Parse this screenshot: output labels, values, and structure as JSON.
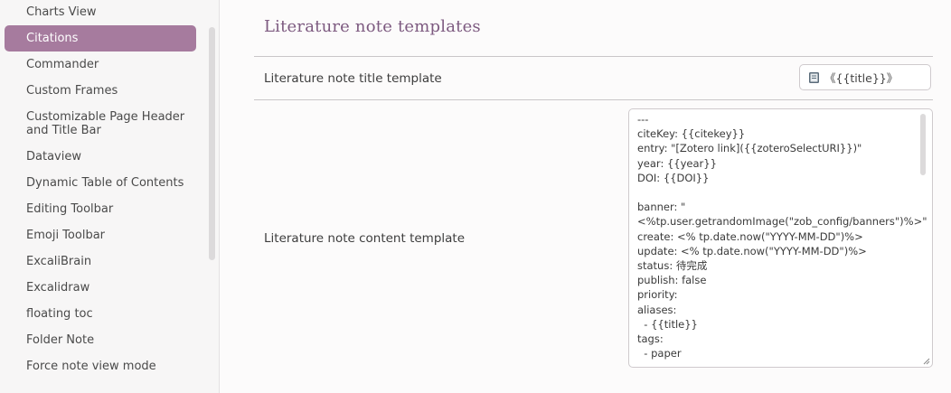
{
  "sidebar": {
    "items": [
      {
        "label": "Charts View",
        "active": false
      },
      {
        "label": "Citations",
        "active": true
      },
      {
        "label": "Commander",
        "active": false
      },
      {
        "label": "Custom Frames",
        "active": false
      },
      {
        "label": "Customizable Page Header and Title Bar",
        "active": false
      },
      {
        "label": "Dataview",
        "active": false
      },
      {
        "label": "Dynamic Table of Contents",
        "active": false
      },
      {
        "label": "Editing Toolbar",
        "active": false
      },
      {
        "label": "Emoji Toolbar",
        "active": false
      },
      {
        "label": "ExcaliBrain",
        "active": false
      },
      {
        "label": "Excalidraw",
        "active": false
      },
      {
        "label": "floating toc",
        "active": false
      },
      {
        "label": "Folder Note",
        "active": false
      },
      {
        "label": "Force note view mode",
        "active": false
      }
    ]
  },
  "main": {
    "section_title": "Literature note templates",
    "title_template": {
      "label": "Literature note title template",
      "value": "《{{title}}》"
    },
    "content_template": {
      "label": "Literature note content template",
      "lines": [
        "---",
        "citeKey: {{citekey}}",
        "entry: \"[Zotero link]({{zoteroSelectURI}})\"",
        "year: {{year}}",
        "DOI: {{DOI}}",
        "",
        "banner: \"",
        "<%tp.user.getrandomImage(\"zob_config/banners\")%>\"",
        "create: <% tp.date.now(\"YYYY-MM-DD\")%>",
        "update: <% tp.date.now(\"YYYY-MM-DD\")%>",
        "status: 待完成",
        "publish: false",
        "priority:",
        "aliases:",
        "  - {{title}}",
        "tags:",
        "  - paper",
        "---"
      ]
    }
  },
  "colors": {
    "accent": "#a67b9e",
    "heading": "#7d5a80"
  },
  "icons": {
    "title_input_icon": "book-icon",
    "resize": "resize-grip-icon"
  }
}
